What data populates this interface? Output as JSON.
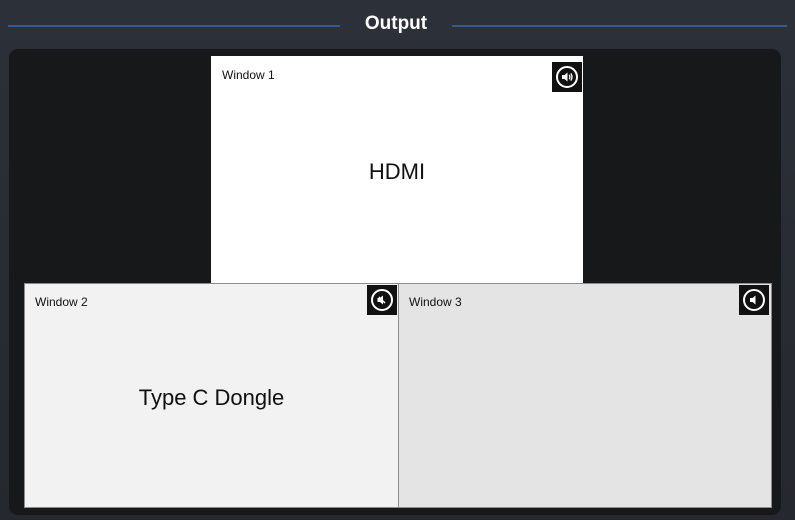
{
  "header": {
    "title": "Output"
  },
  "windows": [
    {
      "label": "Window 1",
      "source": "HDMI",
      "audio_icon": "speaker-on-icon",
      "background": "#ffffff"
    },
    {
      "label": "Window 2",
      "source": "Type C Dongle",
      "audio_icon": "speaker-muted-icon",
      "background": "#f2f2f2"
    },
    {
      "label": "Window 3",
      "source": "",
      "audio_icon": "speaker-muted-icon",
      "background": "#e4e4e4"
    }
  ],
  "colors": {
    "accent_line": "#2f5d8f",
    "panel_bg": "#17181a",
    "header_text": "#ffffff"
  }
}
